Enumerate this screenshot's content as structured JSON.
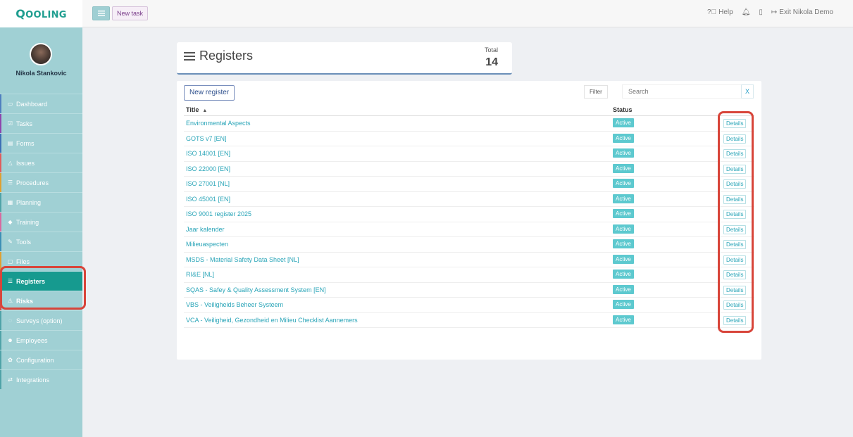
{
  "app": {
    "logo_first": "Q",
    "logo_rest": "OOLING"
  },
  "toolbar": {
    "new_task_label": "New task"
  },
  "topbar_right": {
    "help": "Help",
    "exit": "Exit Nikola Demo"
  },
  "user": {
    "name": "Nikola Stankovic"
  },
  "sidebar": {
    "items": [
      {
        "label": "Dashboard",
        "icon": "monitor-icon",
        "glyph": "▭",
        "accent": "#4f7fbf"
      },
      {
        "label": "Tasks",
        "icon": "check-square-icon",
        "glyph": "☑",
        "accent": "#8e44ad"
      },
      {
        "label": "Forms",
        "icon": "file-icon",
        "glyph": "▤",
        "accent": "#3d6fb6"
      },
      {
        "label": "Issues",
        "icon": "bell-icon",
        "glyph": "△",
        "accent": "#e05c5c"
      },
      {
        "label": "Procedures",
        "icon": "list-icon",
        "glyph": "☰",
        "accent": "#e0a030"
      },
      {
        "label": "Planning",
        "icon": "calendar-icon",
        "glyph": "▦",
        "accent": "#4fa3a8"
      },
      {
        "label": "Training",
        "icon": "graduation-icon",
        "glyph": "◆",
        "accent": "#d86aa0"
      },
      {
        "label": "Tools",
        "icon": "wrench-icon",
        "glyph": "✎",
        "accent": "#3d8fb6"
      },
      {
        "label": "Files",
        "icon": "file-icon",
        "glyph": "▢",
        "accent": "#e0a030"
      },
      {
        "label": "Registers",
        "icon": "list-icon",
        "glyph": "☰",
        "accent": "#169a8f"
      },
      {
        "label": "Risks",
        "icon": "warning-icon",
        "glyph": "⚠",
        "accent": "#d84a4a"
      },
      {
        "label": "Surveys (option)",
        "icon": "comment-icon",
        "glyph": "◌",
        "accent": "#4fa3a8"
      },
      {
        "label": "Employees",
        "icon": "users-icon",
        "glyph": "☻",
        "accent": "#4fa3a8"
      },
      {
        "label": "Configuration",
        "icon": "gear-icon",
        "glyph": "✿",
        "accent": "#4fa3a8"
      },
      {
        "label": "Integrations",
        "icon": "exchange-icon",
        "glyph": "⇄",
        "accent": "#4fa3a8"
      }
    ]
  },
  "page": {
    "title": "Registers",
    "total_label": "Total",
    "total_value": "14"
  },
  "controls": {
    "new_register": "New register",
    "filter": "Filter",
    "search_placeholder": "Search",
    "clear": "X"
  },
  "table": {
    "headers": {
      "title": "Title",
      "status": "Status"
    },
    "rows": [
      {
        "title": "Environmental Aspects",
        "status": "Active",
        "action": "Details"
      },
      {
        "title": "GOTS v7 [EN]",
        "status": "Active",
        "action": "Details"
      },
      {
        "title": "ISO 14001 [EN]",
        "status": "Active",
        "action": "Details"
      },
      {
        "title": "ISO 22000 [EN]",
        "status": "Active",
        "action": "Details"
      },
      {
        "title": "ISO 27001 [NL]",
        "status": "Active",
        "action": "Details"
      },
      {
        "title": "ISO 45001 [EN]",
        "status": "Active",
        "action": "Details"
      },
      {
        "title": "ISO 9001 register 2025",
        "status": "Active",
        "action": "Details"
      },
      {
        "title": "Jaar kalender",
        "status": "Active",
        "action": "Details"
      },
      {
        "title": "Milieuaspecten",
        "status": "Active",
        "action": "Details"
      },
      {
        "title": "MSDS - Material Safety Data Sheet [NL]",
        "status": "Active",
        "action": "Details"
      },
      {
        "title": "RI&E [NL]",
        "status": "Active",
        "action": "Details"
      },
      {
        "title": "SQAS - Safey & Quality Assessment System [EN]",
        "status": "Active",
        "action": "Details"
      },
      {
        "title": "VBS - Veiligheids Beheer Systeem",
        "status": "Active",
        "action": "Details"
      },
      {
        "title": "VCA - Veiligheid, Gezondheid en Milieu Checklist Aannemers",
        "status": "Active",
        "action": "Details"
      }
    ]
  },
  "colors": {
    "brand": "#1f9e90",
    "active_nav": "#169a8f",
    "badge": "#5dc9cf",
    "highlight": "#d8453a"
  }
}
